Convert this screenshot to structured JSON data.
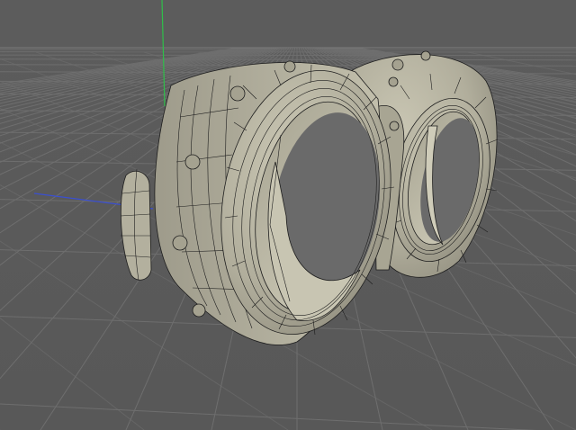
{
  "viewport": {
    "mode": "perspective",
    "background_color": "#5a5a5a",
    "grid_color": "#6b6b6b",
    "horizon_color": "#7a7a7a",
    "axis_colors": {
      "x": "#d04848",
      "y": "#2fbf4a",
      "z": "#3a4fd0"
    },
    "model": {
      "name": "goggles",
      "surface_color": "#b8b5a3",
      "shadow_color": "#8e8b7c",
      "wire_color": "#1e1e1e",
      "parts": [
        "left-lens-ring",
        "right-lens-ring",
        "side-buckle",
        "rivets",
        "bridge"
      ]
    }
  }
}
